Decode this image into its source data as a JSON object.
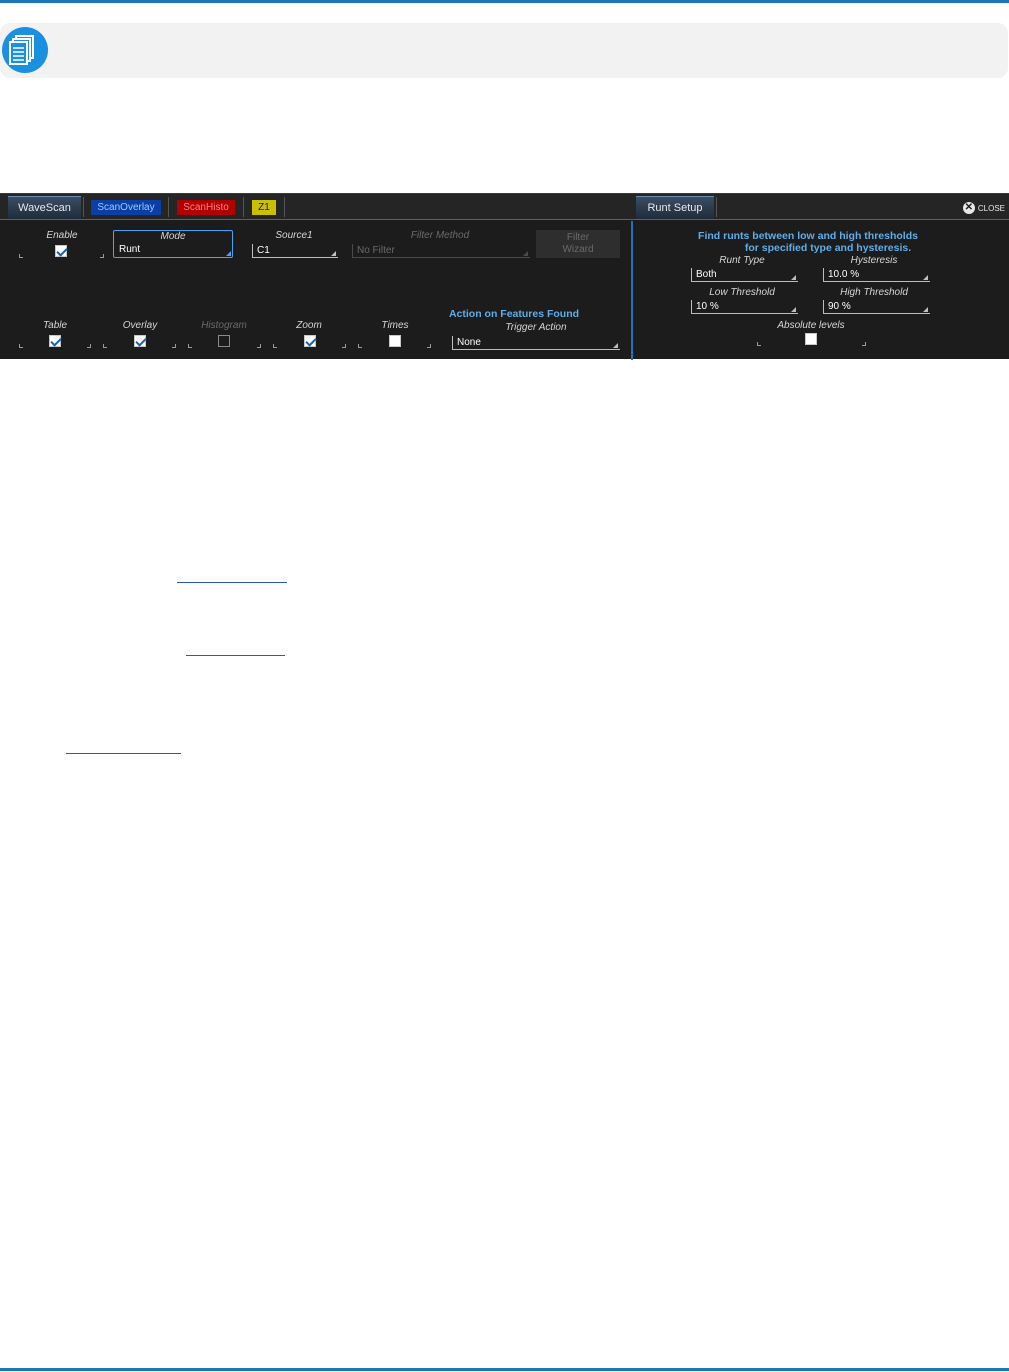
{
  "dialog": {
    "tabs": [
      {
        "label": "WaveScan",
        "color": "#1f2c3a"
      },
      {
        "label": "ScanOverlay",
        "color": "#0a3fa8"
      },
      {
        "label": "ScanHisto",
        "color": "#b00000"
      },
      {
        "label": "Z1",
        "color": "#c8c000"
      }
    ],
    "right_tab": "Runt Setup",
    "close_label": "CLOSE",
    "enable": {
      "label": "Enable",
      "checked": true
    },
    "mode": {
      "label": "Mode",
      "value": "Runt"
    },
    "source1": {
      "label": "Source1",
      "value": "C1"
    },
    "filter_method": {
      "label": "Filter Method",
      "value": "No Filter"
    },
    "filter_wizard": {
      "line1": "Filter",
      "line2": "Wizard"
    },
    "table": {
      "label": "Table",
      "checked": true
    },
    "overlay": {
      "label": "Overlay",
      "checked": true
    },
    "histogram": {
      "label": "Histogram",
      "checked": false
    },
    "zoom": {
      "label": "Zoom",
      "checked": true
    },
    "times": {
      "label": "Times",
      "checked": false
    },
    "action": {
      "title": "Action on Features Found",
      "label": "Trigger Action",
      "value": "None"
    },
    "runt": {
      "desc1": "Find runts between low and high thresholds",
      "desc2": "for specified type and hysteresis.",
      "runt_type": {
        "label": "Runt Type",
        "value": "Both"
      },
      "hysteresis": {
        "label": "Hysteresis",
        "value": "10.0 %"
      },
      "low_threshold": {
        "label": "Low Threshold",
        "value": "10 %"
      },
      "high_threshold": {
        "label": "High Threshold",
        "value": "90 %"
      },
      "absolute_levels": {
        "label": "Absolute levels",
        "checked": false
      }
    }
  },
  "colors": {
    "accent": "#1b75bb",
    "panel": "#1c1c1c",
    "highlight": "#5eaee8"
  }
}
